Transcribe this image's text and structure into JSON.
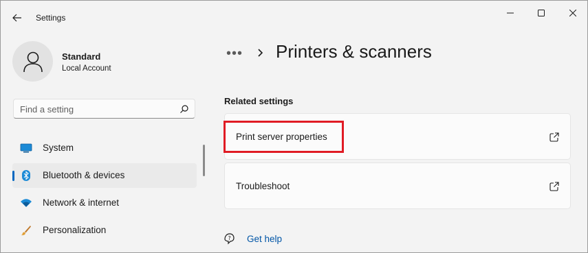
{
  "window": {
    "app_title": "Settings",
    "minimize_glyph": "─",
    "maximize_glyph": "☐",
    "close_glyph": "✕"
  },
  "profile": {
    "name": "Standard",
    "account_type": "Local Account"
  },
  "search": {
    "placeholder": "Find a setting",
    "value": ""
  },
  "sidebar": {
    "items": [
      {
        "label": "System",
        "icon": "system-icon",
        "active": false
      },
      {
        "label": "Bluetooth & devices",
        "icon": "bluetooth-icon",
        "active": true
      },
      {
        "label": "Network & internet",
        "icon": "wifi-icon",
        "active": false
      },
      {
        "label": "Personalization",
        "icon": "brush-icon",
        "active": false
      }
    ]
  },
  "main": {
    "breadcrumb_more": "•••",
    "page_title": "Printers & scanners",
    "section_title": "Related settings",
    "cards": [
      {
        "label": "Print server properties",
        "icon": "external-link-icon"
      },
      {
        "label": "Troubleshoot",
        "icon": "external-link-icon"
      }
    ],
    "help_link": "Get help"
  },
  "colors": {
    "accent": "#0067c0",
    "highlight_box": "#e01b24",
    "link": "#0055a6"
  }
}
